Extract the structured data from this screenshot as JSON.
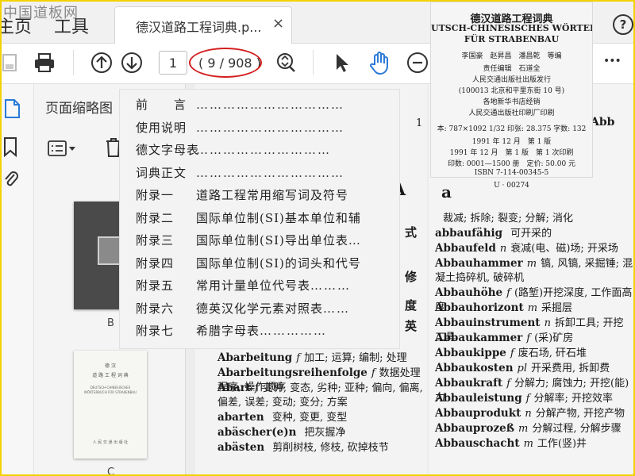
{
  "watermark": "中国道板网",
  "menubar": {
    "home_label": "主页",
    "tools_label": "工具",
    "doc_tab_label": "德汉道路工程词典.p...",
    "close_glyph": "×",
    "help_glyph": "?"
  },
  "toolbar": {
    "page_input_value": "1",
    "page_count": "( 9 / 908 )",
    "more_glyph": "•••"
  },
  "panel": {
    "title": "页面缩略图",
    "thumb_labels": [
      "B",
      "C"
    ],
    "thumb_cover_lines": [
      "德 汉",
      "道 路 工 程 词 典",
      "DEUTSCH-CHINESISCHES",
      "WÖRTERBUCH FÜR STRAßENBAU",
      "人 民 交 通 出 版 社"
    ]
  },
  "toc": {
    "rows": [
      {
        "prefix": "前　　言",
        "title": "",
        "dots": "……………………………"
      },
      {
        "prefix": "使用说明",
        "title": "",
        "dots": "……………………………"
      },
      {
        "prefix": "德文字母表",
        "title": "",
        "dots": "…………………………"
      },
      {
        "prefix": "词典正文",
        "title": "",
        "dots": "……………………………"
      },
      {
        "prefix": "附录一",
        "title": "道路工程常用缩写词及符号",
        "dots": ""
      },
      {
        "prefix": "附录二",
        "title": "国际单位制(SI)基本单位和辅",
        "dots": ""
      },
      {
        "prefix": "附录三",
        "title": "国际单位制(SI)导出单位表",
        "dots": "…"
      },
      {
        "prefix": "附录四",
        "title": "国际单位制(SI)的词头和代号",
        "dots": ""
      },
      {
        "prefix": "附录五",
        "title": "常用计量单位代号表",
        "dots": "………"
      },
      {
        "prefix": "附录六",
        "title": "德英汉化学元素对照表",
        "dots": "……"
      },
      {
        "prefix": "附录七",
        "title": "希腊字母表",
        "dots": "……………"
      }
    ]
  },
  "copyright": {
    "lines": [
      "德汉道路工程词典",
      "UTSCH-CHINESISCHES WÖRTERE",
      "FÜR STRABENBAU",
      "李国豪　赵昇昌　潘昌乾　等编",
      "责任编辑　石道全",
      "人民交通出版社出版发行",
      "(100013 北京和平里东街 10 号)",
      "各地新华书店经销",
      "人民交通出版社印刷厂印刷",
      "本: 787×1092 1/32  印张: 28.375 字数: 132",
      "1991 年 12 月　第 1 版",
      "1991 年 12 月　第 1 版　第 1 次印刷",
      "印数: 0001—1500 册　定价: 50.00 元",
      "ISBN 7-114-00345-5",
      "U · 00274"
    ]
  },
  "page_left": {
    "page_num": "1",
    "letter_a": "A",
    "side_chars": [
      "式",
      "修",
      "度",
      "英"
    ],
    "entries": [
      {
        "word": "Abarbeitung",
        "gram": "f",
        "sense": "加工; 运算; 编制; 处理"
      },
      {
        "word": "Abarbeitungsreihenfolge",
        "gram": "f",
        "sense": "数据处理程序, 操作顺序"
      },
      {
        "word": "Abart",
        "gram": "f",
        "sense": "变种, 变态, 劣种; 亚种; 偏向, 偏离, 偏差, 误差; 变动; 变分; 方案"
      },
      {
        "word": "abarten",
        "gram": "",
        "sense": "变种, 变更, 变型"
      },
      {
        "word": "abäscher(e)n",
        "gram": "",
        "sense": "把灰握净"
      },
      {
        "word": "abästen",
        "gram": "",
        "sense": "剪削树枝, 修枝, 砍掉枝节"
      }
    ]
  },
  "page_right": {
    "header": "Abb",
    "letter": "a",
    "entries": [
      {
        "word": "",
        "gram": "",
        "sense": "裁减; 拆除; 裂变; 分解; 消化"
      },
      {
        "word": "abbaufähig",
        "gram": "",
        "sense": "可开采的"
      },
      {
        "word": "Abbaufeld",
        "gram": "n",
        "sense": "衰减(电、磁)场; 开采场"
      },
      {
        "word": "Abbauhammer",
        "gram": "m",
        "sense": "镐, 风镐, 采掘锤; 混凝土捣碎机, 破碎机"
      },
      {
        "word": "Abbauhöhe",
        "gram": "f",
        "sense": "(路堑)开挖深度, 工作面高度"
      },
      {
        "word": "Abbauhorizont",
        "gram": "m",
        "sense": "采掘层"
      },
      {
        "word": "Abbauinstrument",
        "gram": "n",
        "sense": "拆卸工具; 开挖工具"
      },
      {
        "word": "Abbaukammer",
        "gram": "f",
        "sense": "(采)矿房"
      },
      {
        "word": "Abbaukippe",
        "gram": "f",
        "sense": "废石场, 矸石堆"
      },
      {
        "word": "Abbaukosten",
        "gram": "pl",
        "sense": "开采费用, 拆卸费"
      },
      {
        "word": "Abbaukraft",
        "gram": "f",
        "sense": "分解力; 腐蚀力; 开挖(能)力"
      },
      {
        "word": "Abbauleistung",
        "gram": "f",
        "sense": "分解率; 开挖效率"
      },
      {
        "word": "Abbauprodukt",
        "gram": "n",
        "sense": "分解产物, 开挖产物"
      },
      {
        "word": "Abbauprozeß",
        "gram": "m",
        "sense": "分解过程, 分解步骤"
      },
      {
        "word": "Abbauschacht",
        "gram": "m",
        "sense": "工作(竖)井"
      }
    ]
  },
  "colors": {
    "accent_blue": "#2a7ad8",
    "annotation_red": "#d42020",
    "frame_yellow": "#f2d200"
  }
}
